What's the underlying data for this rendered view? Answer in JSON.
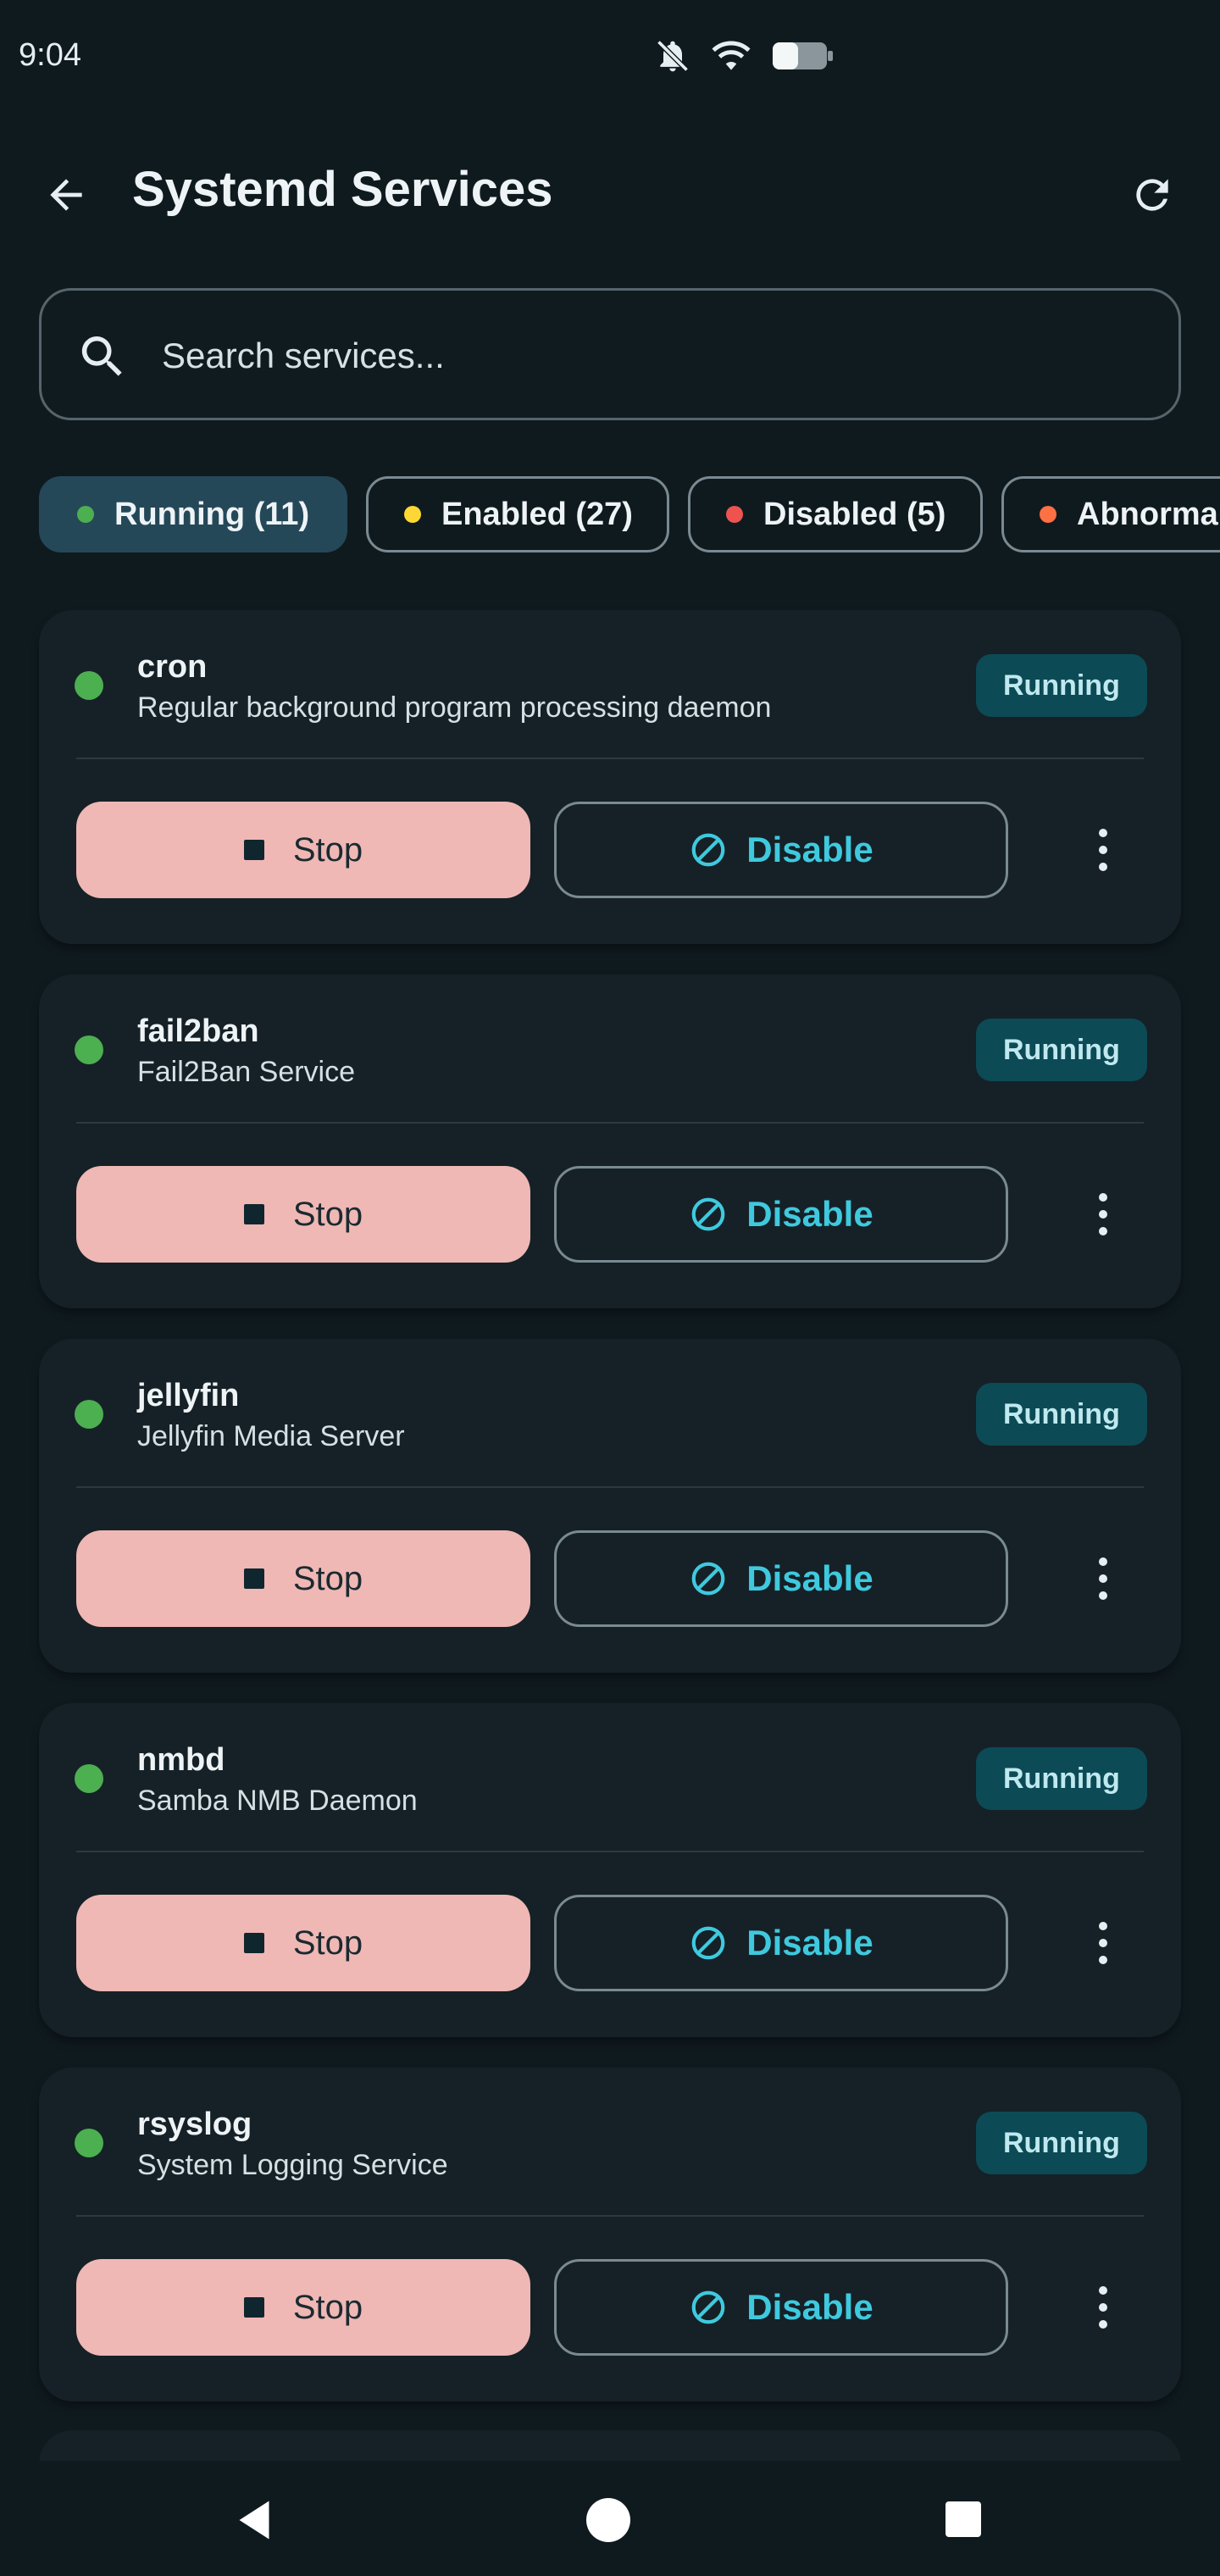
{
  "status_bar": {
    "time": "9:04",
    "icons": [
      "mute-icon",
      "wifi-icon",
      "battery-icon"
    ]
  },
  "header": {
    "title": "Systemd Services",
    "back_icon": "arrow-left-icon",
    "refresh_icon": "refresh-icon"
  },
  "search": {
    "placeholder": "Search services...",
    "value": ""
  },
  "filters": [
    {
      "label": "Running (11)",
      "dot_color": "#4caf50",
      "active": true
    },
    {
      "label": "Enabled (27)",
      "dot_color": "#fdd835",
      "active": false
    },
    {
      "label": "Disabled (5)",
      "dot_color": "#ef5350",
      "active": false
    },
    {
      "label": "Abnormal",
      "dot_color": "#ff7043",
      "active": false
    }
  ],
  "services": [
    {
      "name": "cron",
      "description": "Regular background program processing daemon",
      "status": "Running",
      "stop_label": "Stop",
      "disable_label": "Disable"
    },
    {
      "name": "fail2ban",
      "description": "Fail2Ban Service",
      "status": "Running",
      "stop_label": "Stop",
      "disable_label": "Disable"
    },
    {
      "name": "jellyfin",
      "description": "Jellyfin Media Server",
      "status": "Running",
      "stop_label": "Stop",
      "disable_label": "Disable"
    },
    {
      "name": "nmbd",
      "description": "Samba NMB Daemon",
      "status": "Running",
      "stop_label": "Stop",
      "disable_label": "Disable"
    },
    {
      "name": "rsyslog",
      "description": "System Logging Service",
      "status": "Running",
      "stop_label": "Stop",
      "disable_label": "Disable"
    }
  ],
  "colors": {
    "background": "#0f1a1f",
    "card": "#152127",
    "accent": "#3fc9de",
    "stop": "#efb8b5",
    "running_dot": "#4caf50"
  }
}
